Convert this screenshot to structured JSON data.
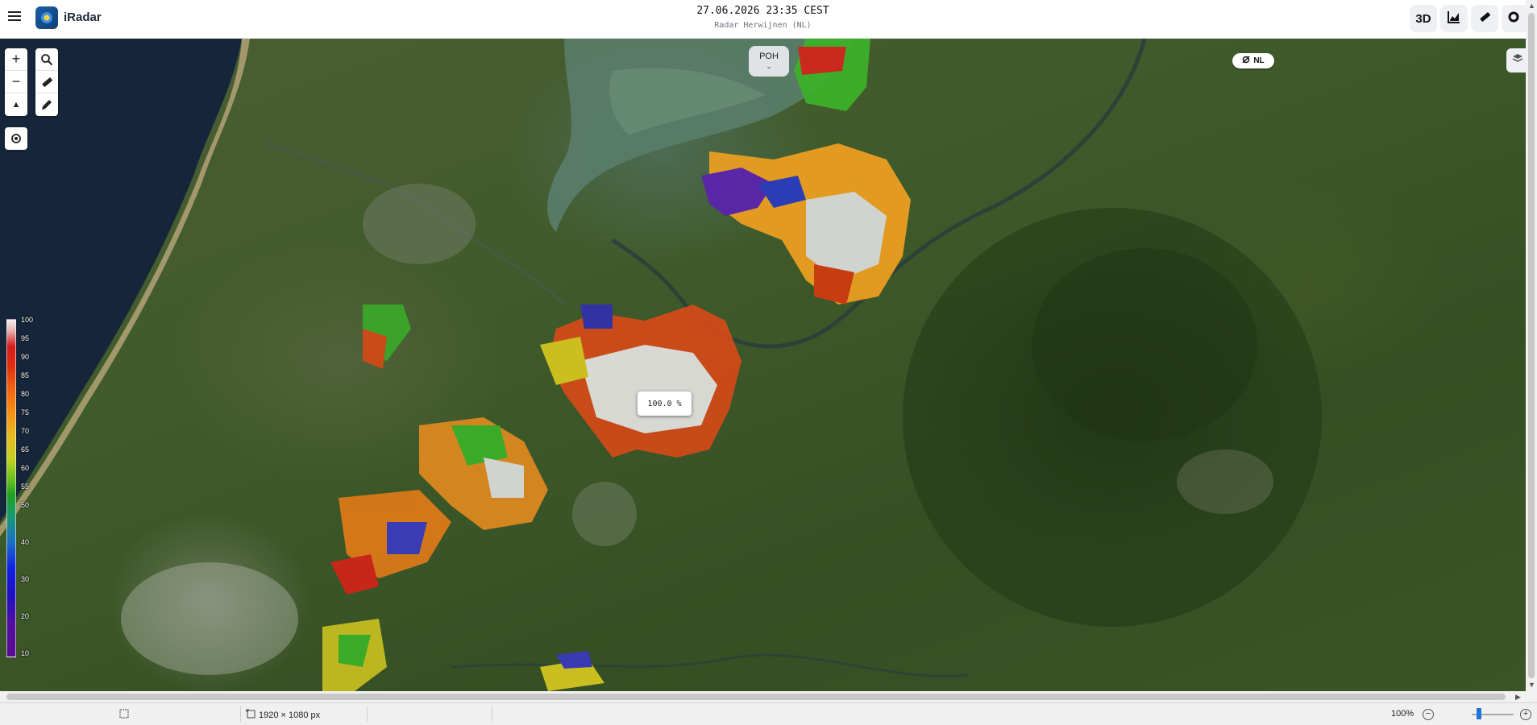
{
  "app": {
    "title": "iRadar"
  },
  "header": {
    "datetime": "27.06.2026 23:35 CEST",
    "subtitle": "Radar Herwijnen (NL)",
    "buttons": {
      "three_d": "3D",
      "chart_icon": "chart-icon",
      "ruler_icon": "ruler-icon",
      "settings_icon": "gear-icon"
    }
  },
  "map": {
    "product_selector": {
      "label": "POH",
      "icon": "chevron-down-icon"
    },
    "country_badge": {
      "label": "NL",
      "icon": "satellite-icon"
    },
    "tooltip": "100.0 %",
    "controls": {
      "zoom_in": "+",
      "zoom_out": "−",
      "compass_icon": "compass-icon",
      "search_icon": "search-icon",
      "ruler_icon": "ruler-icon",
      "pencil_icon": "pencil-icon",
      "locate_icon": "locate-icon"
    },
    "legend": {
      "ticks": [
        "100",
        "95",
        "90",
        "85",
        "80",
        "75",
        "70",
        "65",
        "60",
        "55",
        "50",
        "40",
        "30",
        "20",
        "10"
      ]
    }
  },
  "statusbar": {
    "dimensions": "1920 × 1080 px",
    "zoom": "100%"
  },
  "colors": {
    "water": "#1b2b3f",
    "land": "#3e5a2a",
    "accent": "#1c74d8"
  }
}
